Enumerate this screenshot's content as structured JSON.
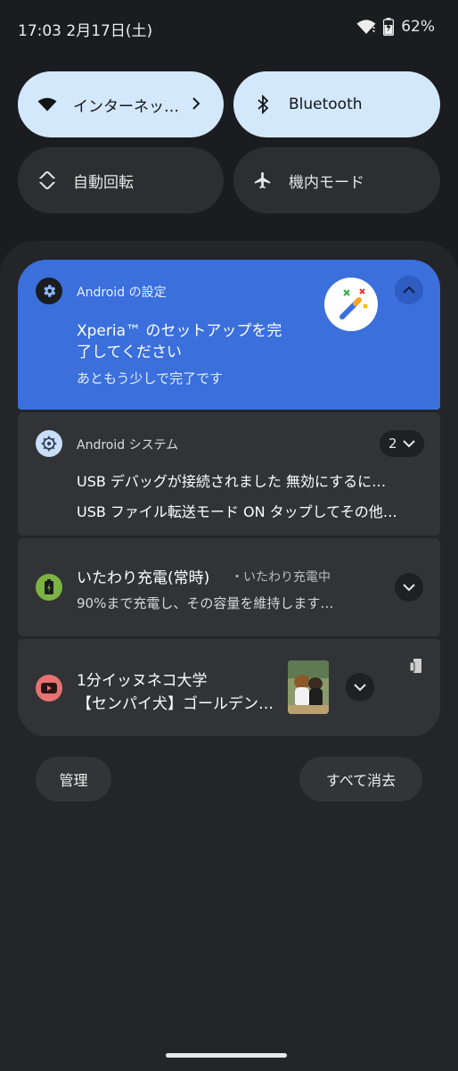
{
  "status_bar": {
    "time_date": "17:03 2月17日(土)",
    "battery": "62%"
  },
  "quick_settings": {
    "tiles": [
      {
        "label": "インターネッ…",
        "state": "on"
      },
      {
        "label": "Bluetooth",
        "state": "on"
      },
      {
        "label": "自動回転",
        "state": "off"
      },
      {
        "label": "機内モード",
        "state": "off"
      }
    ]
  },
  "notifications": [
    {
      "app": "Android の設定",
      "title_line1": "Xperia™ のセットアップを完",
      "title_line2": "了してください",
      "text": "あともう少しで完了です"
    },
    {
      "app": "Android システム",
      "count": "2",
      "line1": "USB デバッグが接続されました 無効にするに…",
      "line2": "USB ファイル転送モード ON タップしてその他…"
    },
    {
      "title": "いたわり充電(常時)",
      "subtitle": "・いたわり充電中",
      "text": "90%まで充電し、その容量を維持します…"
    },
    {
      "title": "1分イッヌネコ大学",
      "text": "【センパイ犬】ゴールデン…"
    }
  ],
  "actions": {
    "manage": "管理",
    "clear_all": "すべて消去"
  },
  "colors": {
    "tile_on": "#d3e8fb",
    "notif_accent": "#3a6fdc",
    "battery_green": "#7cb342",
    "youtube_red": "#e57373"
  }
}
